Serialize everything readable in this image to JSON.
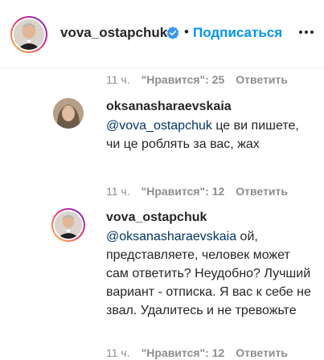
{
  "header": {
    "username": "vova_ostapchuk",
    "separator": "•",
    "follow_label": "Подписаться",
    "verified_icon": "verified-badge-icon",
    "more_icon": "more-options-icon"
  },
  "comments": [
    {
      "time": "11 ч.",
      "likes": "\"Нравится\": 25",
      "reply_label": "Ответить"
    },
    {
      "username": "oksanasharaevskaia",
      "mention": "@vova_ostapchuk",
      "text": " це ви пишете, чи це роблять за вас, жах",
      "time": "11 ч.",
      "likes": "\"Нравится\": 12",
      "reply_label": "Ответить"
    },
    {
      "username": "vova_ostapchuk",
      "mention": "@oksanasharaevskaia",
      "text": " ой, представляете, человек может сам ответить? Неудобно? Лучший вариант - отписка. Я вас к себе не звал. Удалитесь и не тревожьте",
      "time": "11 ч.",
      "likes": "\"Нравится\": 12",
      "reply_label": "Ответить"
    }
  ],
  "colors": {
    "accent": "#0095f6",
    "mention": "#00376b",
    "muted": "#8e8e8e"
  }
}
